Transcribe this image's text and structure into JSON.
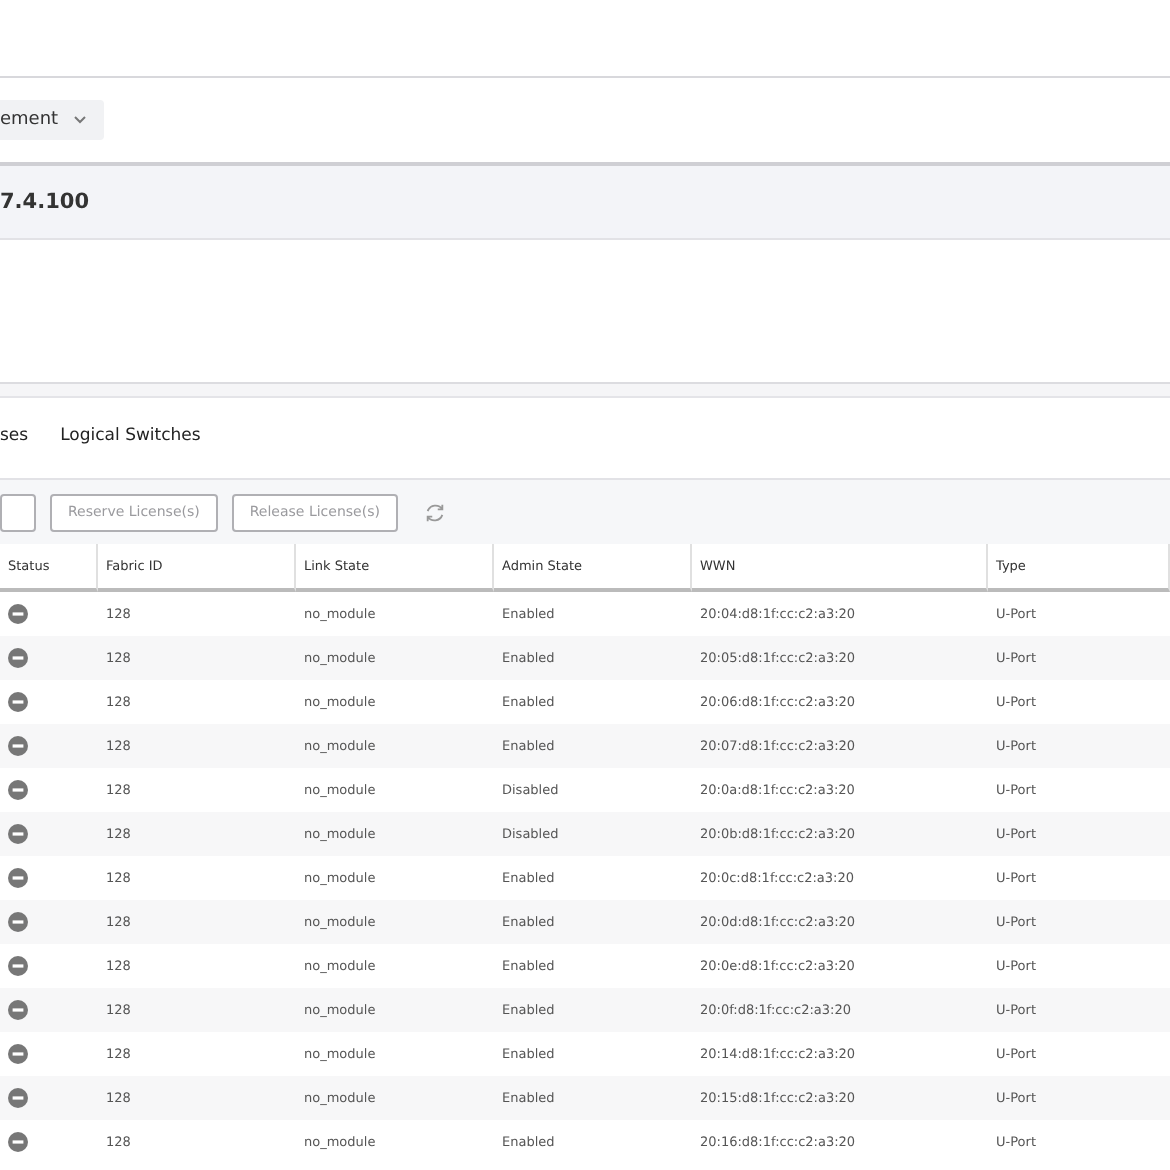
{
  "dropdown": {
    "label": "ement"
  },
  "address": "7.4.100",
  "tabs": [
    {
      "label": "ses",
      "selected": false
    },
    {
      "label": "Logical Switches",
      "selected": false
    }
  ],
  "toolbar": {
    "buttons": [
      {
        "disabled": true
      },
      {
        "label": "Reserve License(s)",
        "disabled": true
      },
      {
        "label": "Release License(s)",
        "disabled": true
      }
    ]
  },
  "table": {
    "columns": [
      "Status",
      "Fabric ID",
      "Link State",
      "Admin State",
      "WWN",
      "Type"
    ],
    "rows": [
      {
        "fabric_id": "128",
        "link_state": "no_module",
        "admin_state": "Enabled",
        "wwn": "20:04:d8:1f:cc:c2:a3:20",
        "type": "U-Port"
      },
      {
        "fabric_id": "128",
        "link_state": "no_module",
        "admin_state": "Enabled",
        "wwn": "20:05:d8:1f:cc:c2:a3:20",
        "type": "U-Port"
      },
      {
        "fabric_id": "128",
        "link_state": "no_module",
        "admin_state": "Enabled",
        "wwn": "20:06:d8:1f:cc:c2:a3:20",
        "type": "U-Port"
      },
      {
        "fabric_id": "128",
        "link_state": "no_module",
        "admin_state": "Enabled",
        "wwn": "20:07:d8:1f:cc:c2:a3:20",
        "type": "U-Port"
      },
      {
        "fabric_id": "128",
        "link_state": "no_module",
        "admin_state": "Disabled",
        "wwn": "20:0a:d8:1f:cc:c2:a3:20",
        "type": "U-Port"
      },
      {
        "fabric_id": "128",
        "link_state": "no_module",
        "admin_state": "Disabled",
        "wwn": "20:0b:d8:1f:cc:c2:a3:20",
        "type": "U-Port"
      },
      {
        "fabric_id": "128",
        "link_state": "no_module",
        "admin_state": "Enabled",
        "wwn": "20:0c:d8:1f:cc:c2:a3:20",
        "type": "U-Port"
      },
      {
        "fabric_id": "128",
        "link_state": "no_module",
        "admin_state": "Enabled",
        "wwn": "20:0d:d8:1f:cc:c2:a3:20",
        "type": "U-Port"
      },
      {
        "fabric_id": "128",
        "link_state": "no_module",
        "admin_state": "Enabled",
        "wwn": "20:0e:d8:1f:cc:c2:a3:20",
        "type": "U-Port"
      },
      {
        "fabric_id": "128",
        "link_state": "no_module",
        "admin_state": "Enabled",
        "wwn": "20:0f:d8:1f:cc:c2:a3:20",
        "type": "U-Port"
      },
      {
        "fabric_id": "128",
        "link_state": "no_module",
        "admin_state": "Enabled",
        "wwn": "20:14:d8:1f:cc:c2:a3:20",
        "type": "U-Port"
      },
      {
        "fabric_id": "128",
        "link_state": "no_module",
        "admin_state": "Enabled",
        "wwn": "20:15:d8:1f:cc:c2:a3:20",
        "type": "U-Port"
      },
      {
        "fabric_id": "128",
        "link_state": "no_module",
        "admin_state": "Enabled",
        "wwn": "20:16:d8:1f:cc:c2:a3:20",
        "type": "U-Port"
      }
    ]
  }
}
